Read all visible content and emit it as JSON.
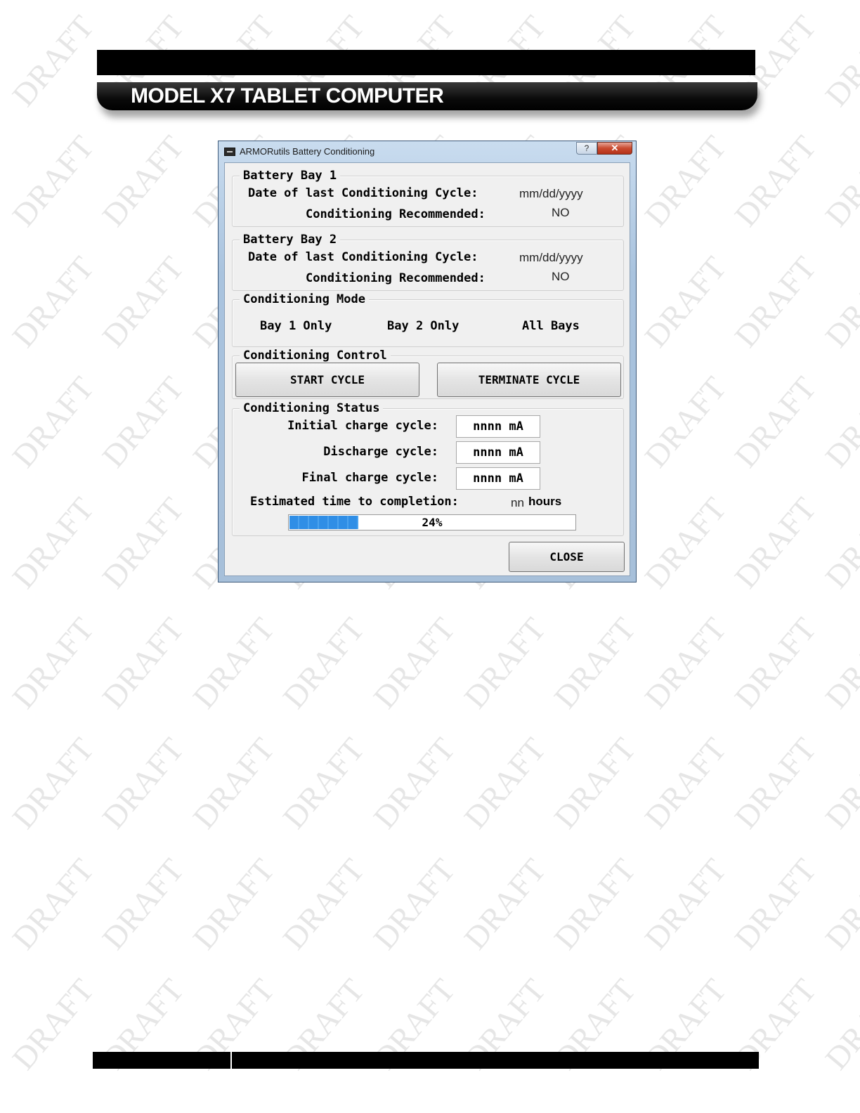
{
  "watermark": "DRAFT",
  "header": {
    "title": "MODEL X7 TABLET COMPUTER"
  },
  "window": {
    "title": "ARMORutils Battery Conditioning",
    "help_glyph": "?",
    "close_glyph": "✕"
  },
  "bay1": {
    "legend": "Battery Bay 1",
    "date_label": "Date of last Conditioning Cycle:",
    "date_value": "mm/dd/yyyy",
    "rec_label": "Conditioning Recommended:",
    "rec_value": "NO"
  },
  "bay2": {
    "legend": "Battery Bay 2",
    "date_label": "Date of last Conditioning Cycle:",
    "date_value": "mm/dd/yyyy",
    "rec_label": "Conditioning Recommended:",
    "rec_value": "NO"
  },
  "mode": {
    "legend": "Conditioning Mode",
    "options": [
      "Bay 1 Only",
      "Bay 2 Only",
      "All Bays"
    ]
  },
  "control": {
    "legend": "Conditioning Control",
    "start_label": "START CYCLE",
    "terminate_label": "TERMINATE CYCLE"
  },
  "status": {
    "legend": "Conditioning Status",
    "initial_label": "Initial charge cycle:",
    "initial_value": "nnnn mA",
    "discharge_label": "Discharge cycle:",
    "discharge_value": "nnnn mA",
    "final_label": "Final charge cycle:",
    "final_value": "nnnn mA",
    "eta_label": "Estimated time to completion:",
    "eta_value": "nn",
    "eta_unit": "hours",
    "progress_percent": 24,
    "progress_text": "24%"
  },
  "footer_buttons": {
    "close_label": "CLOSE"
  },
  "colors": {
    "progress_fill": "#2f8ee6",
    "window_frame": "#a9c3de",
    "close_button": "#c94a2f"
  }
}
